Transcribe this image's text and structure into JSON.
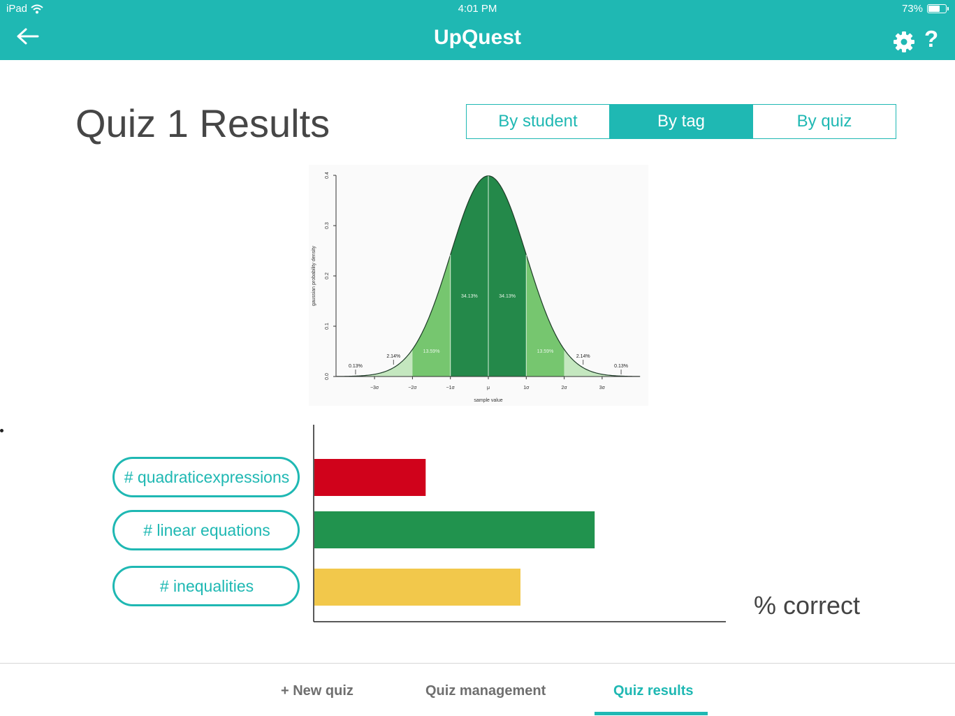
{
  "status_bar": {
    "device": "iPad",
    "time": "4:01 PM",
    "battery": "73%",
    "battery_level": 0.73
  },
  "header": {
    "title": "UpQuest",
    "help_label": "?"
  },
  "page": {
    "title": "Quiz 1 Results"
  },
  "view_tabs": [
    {
      "label": "By student",
      "active": false
    },
    {
      "label": "By tag",
      "active": true
    },
    {
      "label": "By quiz",
      "active": false
    }
  ],
  "distribution_chart": {
    "type": "area",
    "ylabel": "gaussian probability density",
    "xlabel": "sample value",
    "y_ticks": [
      "0.0",
      "0.1",
      "0.2",
      "0.3",
      "0.4"
    ],
    "x_ticks": [
      "−3σ",
      "−2σ",
      "−1σ",
      "μ",
      "1σ",
      "2σ",
      "3σ"
    ],
    "region_labels": [
      "0.13%",
      "2.14%",
      "13.59%",
      "34.13%",
      "34.13%",
      "13.59%",
      "2.14%",
      "0.13%"
    ],
    "ylim": [
      0,
      0.4
    ],
    "colors": {
      "outer": "#c4e7bf",
      "middle": "#76c66f",
      "inner": "#24894a"
    }
  },
  "tag_chart": {
    "type": "bar",
    "categories": [
      "# quadraticexpressions",
      "# linear equations",
      "# inequalities"
    ],
    "values": [
      27,
      68,
      50
    ],
    "xlabel": "% correct",
    "colors": [
      "#d0021b",
      "#21934e",
      "#f2c84b"
    ]
  },
  "bottom_nav": [
    {
      "label": "+ New quiz",
      "active": false
    },
    {
      "label": "Quiz management",
      "active": false
    },
    {
      "label": "Quiz results",
      "active": true
    }
  ],
  "colors": {
    "brand": "#1fb8b3",
    "text": "#444444"
  }
}
